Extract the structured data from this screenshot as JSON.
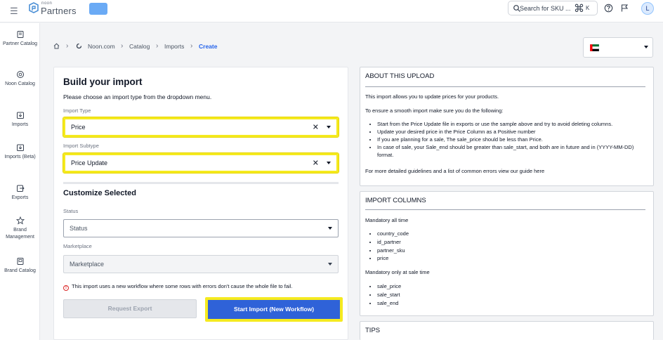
{
  "header": {
    "logo_small": "noon",
    "logo_large": "Partners",
    "search_placeholder": "Search for SKU ...",
    "shortcut_cmd": "⌘",
    "shortcut_key": "K",
    "avatar_initial": "L"
  },
  "sidebar": {
    "items": [
      {
        "label": "Partner Catalog",
        "icon": "catalog-icon"
      },
      {
        "label": "Noon Catalog",
        "icon": "noon-catalog-icon"
      },
      {
        "label": "Imports",
        "icon": "import-icon"
      },
      {
        "label": "Imports (Beta)",
        "icon": "import-beta-icon"
      },
      {
        "label": "Exports",
        "icon": "export-icon"
      },
      {
        "label": "Brand Management",
        "icon": "brand-icon"
      },
      {
        "label": "Brand Catalog",
        "icon": "brand-catalog-icon"
      }
    ]
  },
  "breadcrumb": {
    "items": [
      "Noon.com",
      "Catalog",
      "Imports",
      "Create"
    ]
  },
  "build": {
    "title": "Build your import",
    "subtitle": "Please choose an import type from the dropdown menu.",
    "import_type_label": "Import Type",
    "import_type_value": "Price",
    "import_subtype_label": "Import Subtype",
    "import_subtype_value": "Price Update",
    "customize_title": "Customize Selected",
    "status_label": "Status",
    "status_placeholder": "Status",
    "marketplace_label": "Marketplace",
    "marketplace_placeholder": "Marketplace",
    "info_note": "This import uses a new workflow where some rows with errors don't cause the whole file to fail.",
    "request_export_label": "Request Export",
    "start_import_label": "Start Import (New Workflow)"
  },
  "about": {
    "title": "ABOUT THIS UPLOAD",
    "intro": "This import allows you to update prices for your products.",
    "lead": "To ensure a smooth import make sure you do the following:",
    "bullets": [
      "Start from the Price Update file in exports or use the sample above and try to avoid deleting columns.",
      "Update your desired price in the Price Column as a Positive number",
      "If you are planning for a sale, The sale_price should be less than Price.",
      "In case of sale, your Sale_end should be greater than sale_start, and both are in future and in (YYYY-MM-DD) format."
    ],
    "footer": "For more detailed guidelines and a list of common errors view our guide here"
  },
  "columns": {
    "title": "IMPORT COLUMNS",
    "mandatory_all": "Mandatory all time",
    "all_items": [
      "country_code",
      "id_partner",
      "partner_sku",
      "price"
    ],
    "mandatory_sale": "Mandatory only at sale time",
    "sale_items": [
      "sale_price",
      "sale_start",
      "sale_end"
    ]
  },
  "tips": {
    "title": "TIPS"
  },
  "colors": {
    "accent": "#2f62d8",
    "highlight": "#f5ea1f",
    "breadcrumb_active": "#2563eb"
  }
}
